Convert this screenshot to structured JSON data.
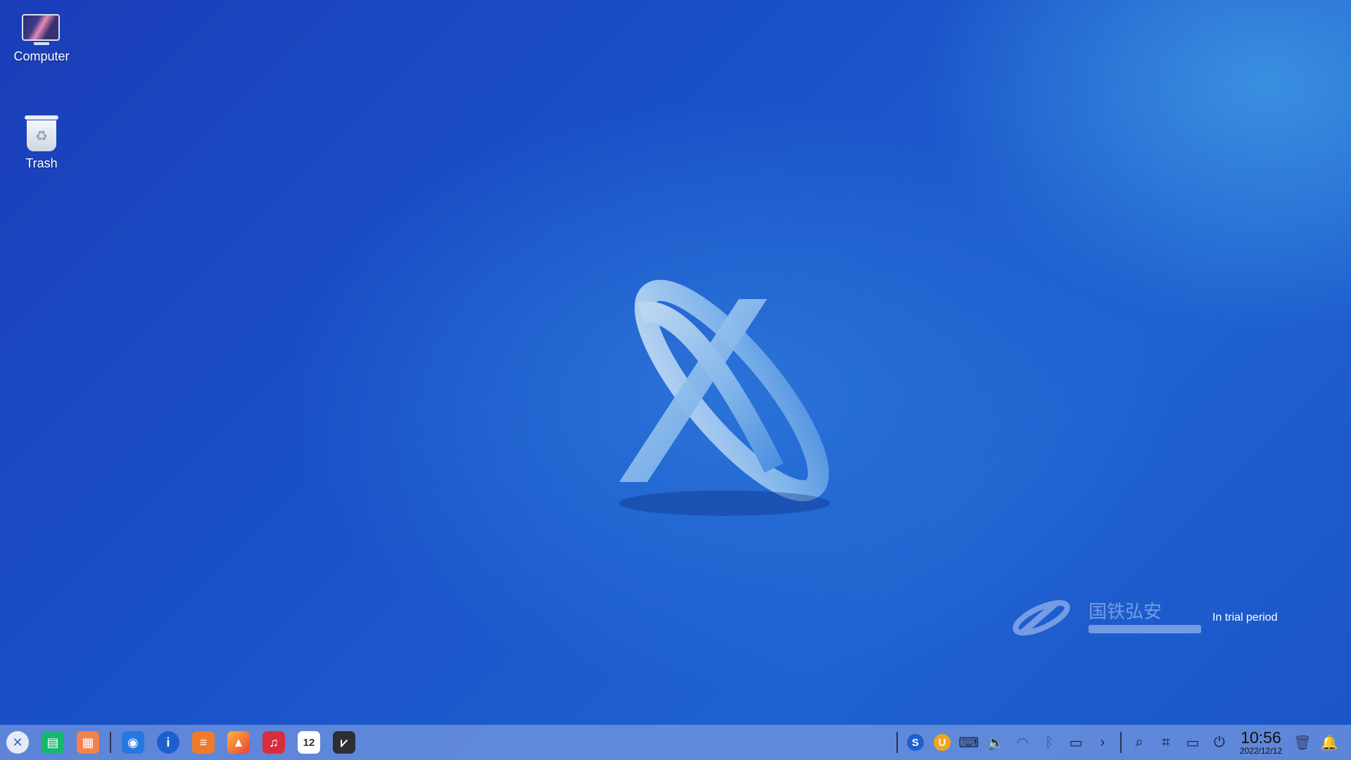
{
  "desktop": {
    "icons": [
      {
        "label": "Computer"
      },
      {
        "label": "Trash"
      }
    ],
    "watermark": {
      "text": "In trial period",
      "logo_text": "国铁弘安"
    }
  },
  "taskbar": {
    "apps": [
      {
        "name": "start-menu"
      },
      {
        "name": "multitasking"
      },
      {
        "name": "app-store"
      },
      {
        "name": "file-manager"
      },
      {
        "name": "browser"
      },
      {
        "name": "text-editor"
      },
      {
        "name": "image-viewer"
      },
      {
        "name": "music-player"
      },
      {
        "name": "calendar",
        "text": "12"
      },
      {
        "name": "terminal"
      }
    ],
    "tray": {
      "clock_time": "10:56",
      "clock_date": "2022/12/12"
    }
  },
  "colors": {
    "desktop_bg": "#1a52c8",
    "taskbar_bg": "#96afe6"
  }
}
